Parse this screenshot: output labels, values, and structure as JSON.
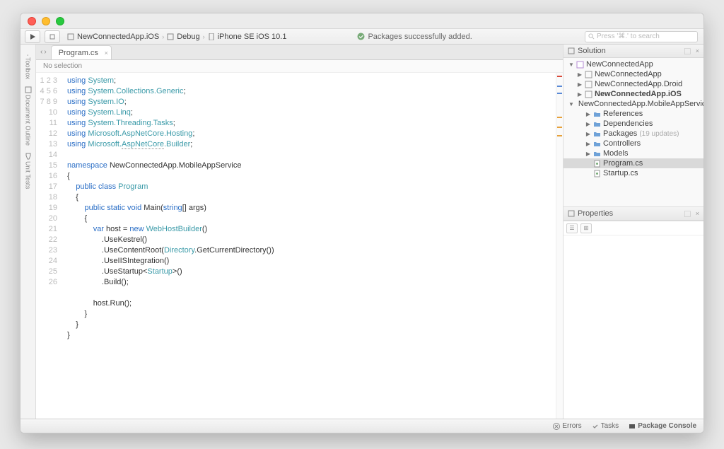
{
  "toolbar": {
    "breadcrumb": {
      "project": "NewConnectedApp.iOS",
      "config": "Debug",
      "device": "iPhone SE iOS 10.1"
    },
    "status": "Packages successfully added.",
    "search_placeholder": "Press '⌘.' to search"
  },
  "left_rail": {
    "items": [
      "Toolbox",
      "Document Outline",
      "Unit Tests"
    ]
  },
  "editor": {
    "tab": "Program.cs",
    "selection_text": "No selection",
    "lines": 26
  },
  "code": {
    "l1": {
      "using": "using",
      "sys": "System"
    },
    "l2": {
      "using": "using",
      "ns": "System.Collections.Generic"
    },
    "l3": {
      "using": "using",
      "ns": "System.IO"
    },
    "l4": {
      "using": "using",
      "ns": "System.Linq"
    },
    "l5": {
      "using": "using",
      "ns": "System.Threading.Tasks"
    },
    "l6": {
      "using": "using",
      "ns": "Microsoft.AspNetCore.Hosting"
    },
    "l7": {
      "using": "using",
      "ns1": "Microsoft.",
      "ns2": "AspNetCore",
      "ns3": ".Builder"
    },
    "l9": {
      "kw": "namespace",
      "ns": "NewConnectedApp.MobileAppService"
    },
    "l10": "{",
    "l11": {
      "kw1": "public",
      "kw2": "class",
      "name": "Program"
    },
    "l12": "    {",
    "l13": {
      "kw1": "public",
      "kw2": "static",
      "kw3": "void",
      "name": "Main",
      "pt": "string",
      "rest": "[] args)"
    },
    "l14": "        {",
    "l15": {
      "kw": "var",
      "txt1": " host = ",
      "kw2": "new",
      "type": "WebHostBuilder",
      "rest": "()"
    },
    "l16": ".UseKestrel()",
    "l17a": ".UseContentRoot(",
    "l17b": "Directory",
    "l17c": ".GetCurrentDirectory())",
    "l18": ".UseIISIntegration()",
    "l19a": ".UseStartup<",
    "l19b": "Startup",
    "l19c": ">()",
    "l20": ".Build();",
    "l22": "host.Run();",
    "l23": "        }",
    "l24": "    }",
    "l25": "}"
  },
  "solution": {
    "title": "Solution",
    "root": "NewConnectedApp",
    "projects": [
      {
        "name": "NewConnectedApp",
        "bold": false
      },
      {
        "name": "NewConnectedApp.Droid",
        "bold": false
      },
      {
        "name": "NewConnectedApp.iOS",
        "bold": true
      },
      {
        "name": "NewConnectedApp.MobileAppService",
        "bold": false,
        "expanded": true
      }
    ],
    "svc_children": [
      {
        "name": "References",
        "icon": "folder"
      },
      {
        "name": "Dependencies",
        "icon": "folder"
      },
      {
        "name": "Packages",
        "icon": "folder",
        "suffix": "(19 updates)"
      },
      {
        "name": "Controllers",
        "icon": "folder"
      },
      {
        "name": "Models",
        "icon": "folder"
      },
      {
        "name": "Program.cs",
        "icon": "file",
        "selected": true
      },
      {
        "name": "Startup.cs",
        "icon": "file"
      }
    ]
  },
  "properties": {
    "title": "Properties"
  },
  "statusbar": {
    "errors": "Errors",
    "tasks": "Tasks",
    "console": "Package Console"
  }
}
